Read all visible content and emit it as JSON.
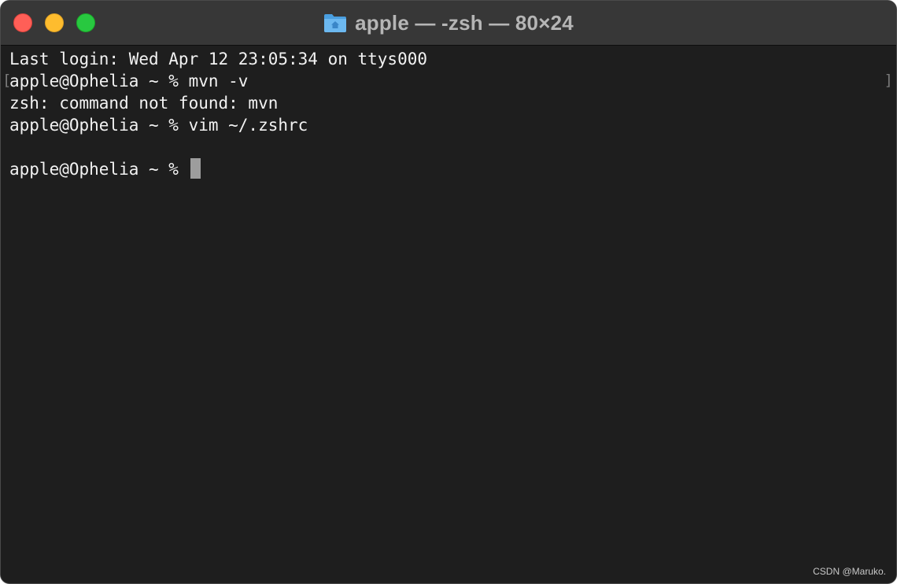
{
  "window": {
    "title": "apple — -zsh — 80×24",
    "title_icon": "folder-icon",
    "traffic_lights": {
      "close": "#ff5f57",
      "minimize": "#febc2e",
      "zoom": "#28c840"
    }
  },
  "terminal": {
    "background": "#1e1e1e",
    "lines": [
      "Last login: Wed Apr 12 23:05:34 on ttys000",
      "apple@Ophelia ~ % mvn -v",
      "zsh: command not found: mvn",
      "apple@Ophelia ~ % vim ~/.zshrc",
      "",
      "apple@Ophelia ~ % "
    ],
    "mark_left": "[",
    "mark_right": "]"
  },
  "watermark": "CSDN @Maruko."
}
